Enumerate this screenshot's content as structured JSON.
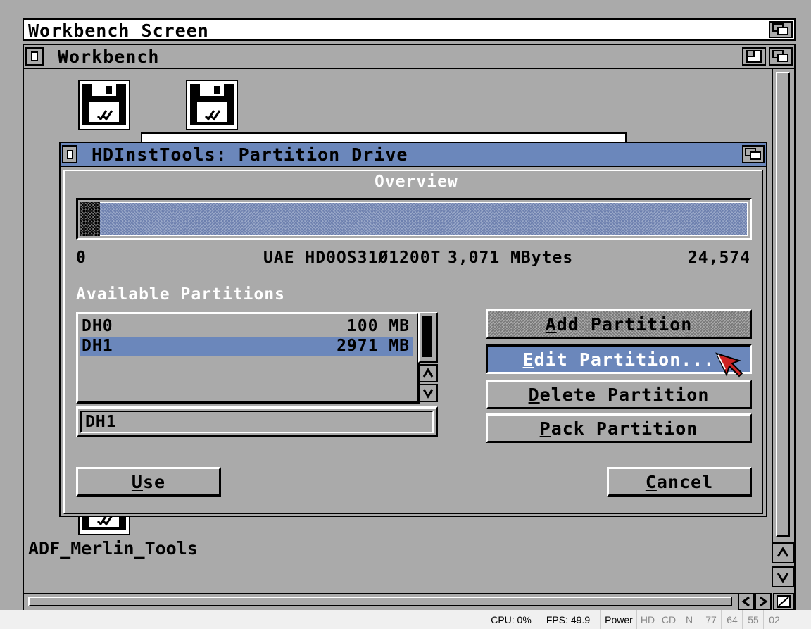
{
  "screen": {
    "title": "Workbench Screen"
  },
  "workbench": {
    "title": "Workbench",
    "icons": [
      {
        "label": "ADF_Merlin_Tools"
      }
    ]
  },
  "dialog": {
    "title": "HDInstTools: Partition Drive",
    "overview_label": "Overview",
    "overview_used_fraction": 0.03,
    "scale_start": "0",
    "drive_name": "UAE HD0OS31Ø1200T",
    "drive_size": "3,071 MBytes",
    "scale_end": "24,574",
    "partitions_label": "Available Partitions",
    "partitions": [
      {
        "name": "DH0",
        "size": "100 MB",
        "selected": false
      },
      {
        "name": "DH1",
        "size": "2971 MB",
        "selected": true
      }
    ],
    "partition_name_value": "DH1",
    "buttons": {
      "add": {
        "hot": "A",
        "rest": "dd Partition"
      },
      "edit": {
        "hot": "E",
        "rest": "dit Partition..."
      },
      "delete": {
        "hot": "D",
        "rest": "elete Partition"
      },
      "pack": {
        "hot": "P",
        "rest": "ack Partition"
      },
      "use": {
        "hot": "U",
        "rest": "se"
      },
      "cancel": {
        "hot": "C",
        "rest": "ancel"
      }
    }
  },
  "statusbar": {
    "cpu": "CPU: 0%",
    "fps": "FPS: 49.9",
    "power": "Power",
    "hd": "HD",
    "cd": "CD",
    "n": "N",
    "d1": "77",
    "d2": "64",
    "d3": "55",
    "d4": "02"
  },
  "colors": {
    "background": "#aaaaaa",
    "title_blue": "#6b87bb",
    "selection_blue": "#6b87bb"
  }
}
